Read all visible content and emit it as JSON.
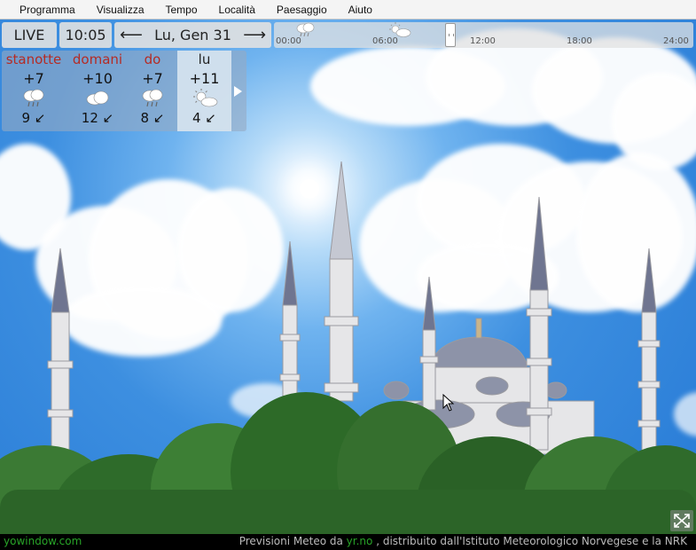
{
  "menu": [
    "Programma",
    "Visualizza",
    "Tempo",
    "Località",
    "Paesaggio",
    "Aiuto"
  ],
  "toolbar": {
    "live_label": "LIVE",
    "time": "10:05",
    "date": "Lu, Gen 31",
    "prev_icon": "arrow-left-icon",
    "next_icon": "arrow-right-icon"
  },
  "timeline": {
    "labels": [
      "00:00",
      "06:00",
      "12:00",
      "18:00",
      "24:00"
    ],
    "icons": [
      "rain-cloud-icon",
      "sun-cloud-icon"
    ]
  },
  "forecast": [
    {
      "name": "stanotte",
      "temp": "+7",
      "icon": "rain-cloud-icon",
      "wind": "9 ↙"
    },
    {
      "name": "domani",
      "temp": "+10",
      "icon": "cloud-icon",
      "wind": "12 ↙"
    },
    {
      "name": "do",
      "temp": "+7",
      "icon": "rain-cloud-icon",
      "wind": "8 ↙"
    },
    {
      "name": "lu",
      "temp": "+11",
      "icon": "sun-cloud-icon",
      "wind": "4 ↙"
    }
  ],
  "status": {
    "brand": "yowindow.com",
    "credit_prefix": "Previsioni Meteo da ",
    "credit_link": "yr.no",
    "credit_suffix": ", distribuito dall'Istituto Meteorologico Norvegese e la NRK"
  },
  "colors": {
    "day_name": "#b52b24",
    "brand": "#28a428",
    "sky": "#3d8fe0"
  }
}
